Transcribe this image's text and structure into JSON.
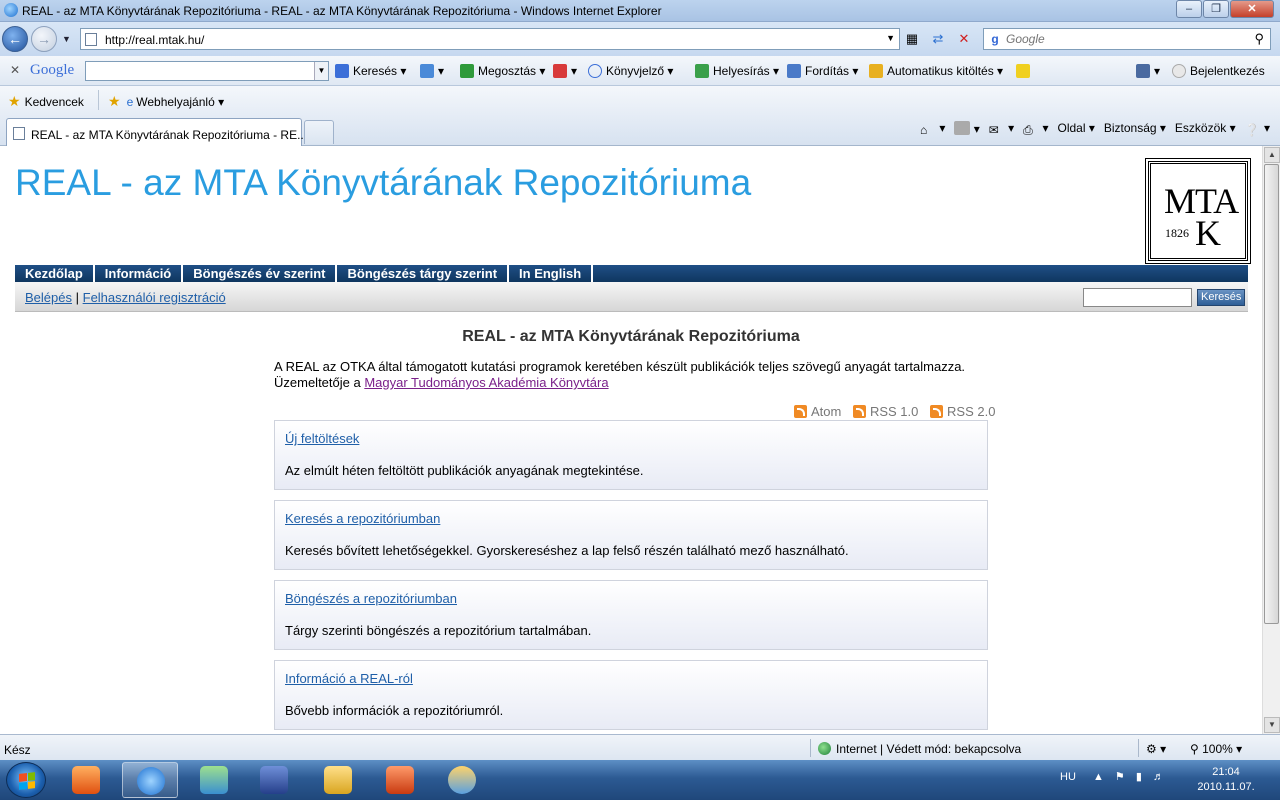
{
  "window": {
    "title": "REAL - az MTA Könyvtárának Repozitóriuma - REAL - az MTA Könyvtárának Repozitóriuma - Windows Internet Explorer",
    "url": "http://real.mtak.hu/",
    "search_placeholder": "Google"
  },
  "google_toolbar": {
    "logo": "Google",
    "items": [
      "Keresés",
      "Megosztás",
      "Könyvjelző",
      "Helyesírás",
      "Fordítás",
      "Automatikus kitöltés",
      "Bejelentkezés"
    ]
  },
  "favorites": {
    "favorites_label": "Kedvencek",
    "web_slice": "Webhelyajánló"
  },
  "tab": {
    "title": "REAL - az MTA Könyvtárának Repozitóriuma - RE..."
  },
  "command_bar": {
    "page": "Oldal",
    "safety": "Biztonság",
    "tools": "Eszközök"
  },
  "page": {
    "site_title": "REAL - az MTA Könyvtárának Repozitóriuma",
    "logo": {
      "letters_top": "MTA",
      "letter_bottom": "K",
      "year": "1826"
    },
    "menu": [
      "Kezdőlap",
      "Információ",
      "Böngészés év szerint",
      "Böngészés tárgy szerint",
      "In English"
    ],
    "login": "Belépés",
    "separator": "|",
    "register": "Felhasználói regisztráció",
    "search_button": "Keresés",
    "main_title": "REAL - az MTA Könyvtárának Repozitóriuma",
    "intro_text": "A REAL az OTKA által támogatott kutatási programok keretében készült publikációk teljes szövegű anyagát tartalmazza. Üzemeltetője a ",
    "intro_link": "Magyar Tudományos Akadémia Könyvtára",
    "feeds": [
      "Atom",
      "RSS 1.0",
      "RSS 2.0"
    ],
    "boxes": [
      {
        "link": "Új feltöltések",
        "desc": "Az elmúlt héten feltöltött publikációk anyagának megtekintése."
      },
      {
        "link": "Keresés a repozitóriumban",
        "desc": "Keresés bővített lehetőségekkel. Gyorskereséshez a lap felső részén található mező használható."
      },
      {
        "link": "Böngészés a repozitóriumban",
        "desc": "Tárgy szerinti böngészés a repozitórium tartalmában."
      },
      {
        "link": "Információ a REAL-ról",
        "desc": "Bővebb információk a repozitóriumról."
      }
    ]
  },
  "status": {
    "text": "Kész",
    "zone": "Internet | Védett mód: bekapcsolva",
    "zoom": "100%"
  },
  "taskbar": {
    "language": "HU",
    "time": "21:04",
    "date": "2010.11.07."
  }
}
